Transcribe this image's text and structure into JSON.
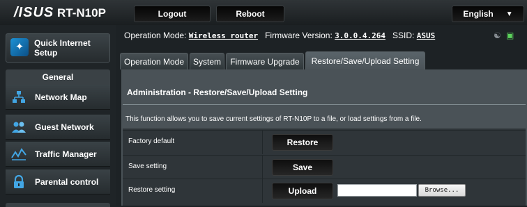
{
  "header": {
    "brand": "/ISUS",
    "model": "RT-N10P",
    "logout_label": "Logout",
    "reboot_label": "Reboot",
    "language": "English"
  },
  "sidebar": {
    "quick_setup_label": "Quick Internet Setup",
    "section_header": "General",
    "items": [
      {
        "label": "Network Map",
        "icon": "network-map-icon"
      },
      {
        "label": "Guest Network",
        "icon": "guest-network-icon"
      },
      {
        "label": "Traffic Manager",
        "icon": "traffic-manager-icon"
      },
      {
        "label": "Parental control",
        "icon": "lock-icon"
      }
    ]
  },
  "infobar": {
    "mode_label": "Operation Mode:",
    "mode_value": "Wireless router",
    "fw_label": "Firmware Version:",
    "fw_value": "3.0.0.4.264",
    "ssid_label": "SSID:",
    "ssid_value": "ASUS"
  },
  "tabs": [
    {
      "label": "Operation Mode"
    },
    {
      "label": "System"
    },
    {
      "label": "Firmware Upgrade"
    },
    {
      "label": "Restore/Save/Upload Setting",
      "active": true
    }
  ],
  "main": {
    "title": "Administration - Restore/Save/Upload Setting",
    "description": "This function allows you to save current settings of RT-N10P to a file, or load settings from a file.",
    "rows": [
      {
        "label": "Factory default",
        "button": "Restore"
      },
      {
        "label": "Save setting",
        "button": "Save"
      },
      {
        "label": "Restore setting",
        "button": "Upload",
        "file_value": "",
        "browse_label": "Browse..."
      }
    ]
  },
  "colors": {
    "accent": "#42a6e4",
    "panel": "#4a5257",
    "status_online": "#5cd35c"
  }
}
